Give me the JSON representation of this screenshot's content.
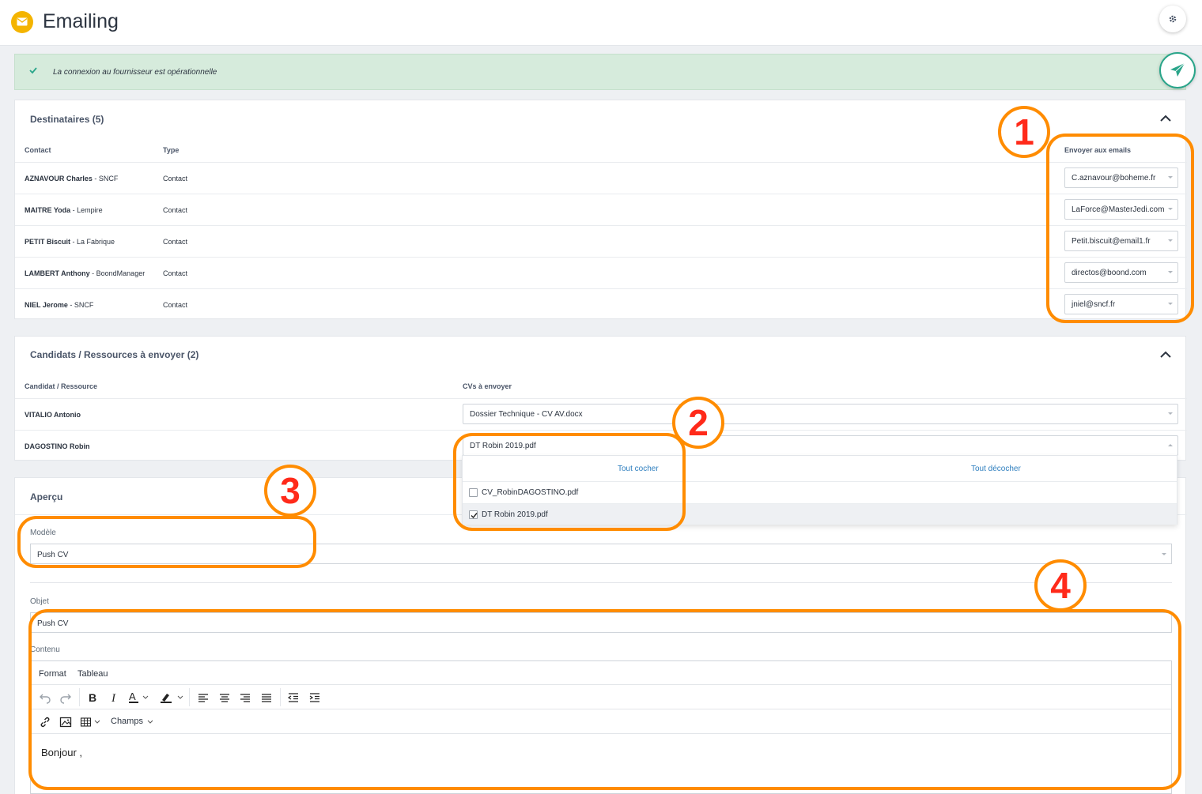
{
  "header": {
    "title": "Emailing"
  },
  "alert": {
    "message": "La connexion au fournisseur est opérationnelle"
  },
  "recipients": {
    "title": "Destinataires (5)",
    "columns": {
      "contact": "Contact",
      "type": "Type",
      "emails": "Envoyer aux emails"
    },
    "rows": [
      {
        "name": "AZNAVOUR Charles",
        "company": " - SNCF",
        "type": "Contact",
        "email": "C.aznavour@boheme.fr"
      },
      {
        "name": "MAITRE Yoda",
        "company": " - Lempire",
        "type": "Contact",
        "email": "LaForce@MasterJedi.com"
      },
      {
        "name": "PETIT Biscuit",
        "company": " - La Fabrique",
        "type": "Contact",
        "email": "Petit.biscuit@email1.fr"
      },
      {
        "name": "LAMBERT Anthony",
        "company": " - BoondManager",
        "type": "Contact",
        "email": "directos@boond.com"
      },
      {
        "name": "NIEL Jerome",
        "company": " - SNCF",
        "type": "Contact",
        "email": "jniel@sncf.fr"
      }
    ]
  },
  "candidates": {
    "title": "Candidats / Ressources à envoyer (2)",
    "columns": {
      "candidate": "Candidat / Ressource",
      "cvs": "CVs à envoyer"
    },
    "rows": [
      {
        "name": "VITALIO Antonio",
        "cv": "Dossier Technique - CV AV.docx"
      },
      {
        "name": "DAGOSTINO Robin",
        "cv": "DT Robin 2019.pdf"
      }
    ],
    "dropdown": {
      "check_all": "Tout cocher",
      "uncheck_all": "Tout décocher",
      "options": [
        {
          "label": "CV_RobinDAGOSTINO.pdf",
          "checked": false
        },
        {
          "label": "DT Robin 2019.pdf",
          "checked": true
        }
      ]
    }
  },
  "preview": {
    "title": "Aperçu",
    "model_label": "Modèle",
    "model_value": "Push CV",
    "subject_label": "Objet",
    "subject_value": "Push CV",
    "content_label": "Contenu",
    "menu": {
      "format": "Format",
      "table": "Tableau"
    },
    "fields_button": "Champs",
    "body_text": "Bonjour ,"
  },
  "annotations": {
    "n1": "1",
    "n2": "2",
    "n3": "3",
    "n4": "4"
  },
  "colors": {
    "accent_orange": "#ff8c00",
    "number_red": "#ff2a1a",
    "success_bg": "#d6ebdc",
    "brand_yellow": "#f4b400",
    "send_green": "#2aa58a"
  }
}
